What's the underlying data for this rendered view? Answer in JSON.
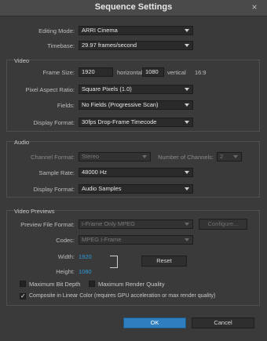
{
  "window": {
    "title": "Sequence Settings",
    "close_glyph": "×"
  },
  "editing_mode": {
    "label": "Editing Mode:",
    "value": "ARRI Cinema"
  },
  "timebase": {
    "label": "Timebase:",
    "value": "29.97 frames/second"
  },
  "video": {
    "section_label": "Video",
    "frame_size_label": "Frame Size:",
    "horizontal": "1920",
    "horizontal_label": "horizontal",
    "vertical": "1080",
    "vertical_label": "vertical",
    "aspect": "16:9",
    "par_label": "Pixel Aspect Ratio:",
    "par_value": "Square Pixels (1.0)",
    "fields_label": "Fields:",
    "fields_value": "No Fields (Progressive Scan)",
    "display_format_label": "Display Format:",
    "display_format_value": "30fps Drop-Frame Timecode"
  },
  "audio": {
    "section_label": "Audio",
    "channel_format_label": "Channel Format:",
    "channel_format_value": "Stereo",
    "num_channels_label": "Number of Channels:",
    "num_channels_value": "2",
    "sample_rate_label": "Sample Rate:",
    "sample_rate_value": "48000 Hz",
    "display_format_label": "Display Format:",
    "display_format_value": "Audio Samples"
  },
  "previews": {
    "section_label": "Video Previews",
    "file_format_label": "Preview File Format:",
    "file_format_value": "I-Frame Only MPEG",
    "configure_label": "Configure...",
    "codec_label": "Codec:",
    "codec_value": "MPEG I-Frame",
    "width_label": "Width:",
    "width_value": "1920",
    "height_label": "Height:",
    "height_value": "1080",
    "reset_label": "Reset"
  },
  "options": {
    "max_bit_depth": {
      "label": "Maximum Bit Depth",
      "checked": false
    },
    "max_render_quality": {
      "label": "Maximum Render Quality",
      "checked": false
    },
    "composite_linear": {
      "label": "Composite in Linear Color (requires GPU acceleration or max render quality)",
      "checked": true
    },
    "check_glyph": "✓"
  },
  "footer": {
    "ok_label": "OK",
    "cancel_label": "Cancel"
  }
}
